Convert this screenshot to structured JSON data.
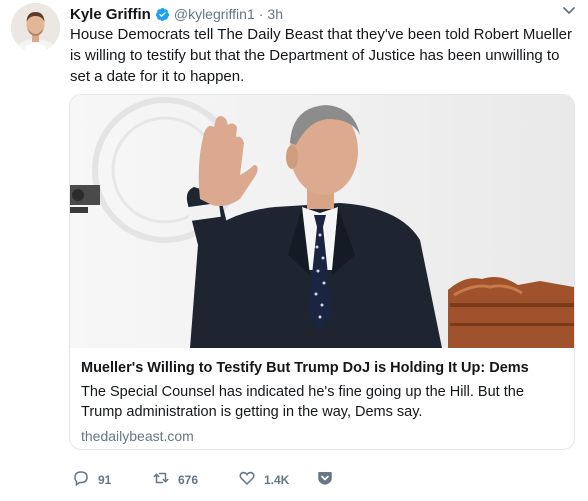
{
  "tweet": {
    "author_name": "Kyle Griffin",
    "author_handle": "@kylegriffin1",
    "separator": "·",
    "timestamp": "3h",
    "text": "House Democrats tell The Daily Beast that they've been told Robert Mueller is willing to testify but that the Department of Justice has been unwilling to set a date for it to happen."
  },
  "card": {
    "title": "Mueller's Willing to Testify But Trump DoJ is Holding It Up: Dems",
    "description": "The Special Counsel has indicated he's fine going up the Hill. But the Trump administration is getting in the way, Dems say.",
    "domain": "thedailybeast.com"
  },
  "actions": {
    "replies": "91",
    "retweets": "676",
    "likes": "1.4K"
  },
  "colors": {
    "verified_blue": "#1da1f2",
    "muted_text": "#657786",
    "border": "#e1e8ed",
    "like_red": "#e0245e"
  }
}
